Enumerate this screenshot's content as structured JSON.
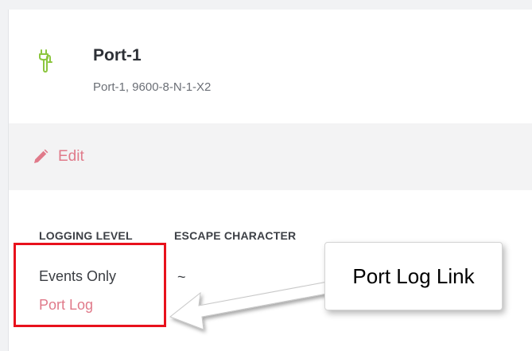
{
  "port": {
    "title": "Port-1",
    "subtitle": "Port-1, 9600-8-N-1-X2",
    "icon": "serial-port-icon",
    "icon_color": "#8cc63f"
  },
  "toolbar": {
    "edit_label": "Edit",
    "edit_icon": "pencil-icon",
    "accent_color": "#e07a8a"
  },
  "details": {
    "columns": [
      "LOGGING LEVEL",
      "ESCAPE CHARACTER"
    ],
    "logging_level_value": "Events Only",
    "escape_character_value": "~",
    "port_log_link": "Port Log"
  },
  "annotation": {
    "callout_text": "Port Log Link",
    "highlight_color": "#e8111c"
  }
}
